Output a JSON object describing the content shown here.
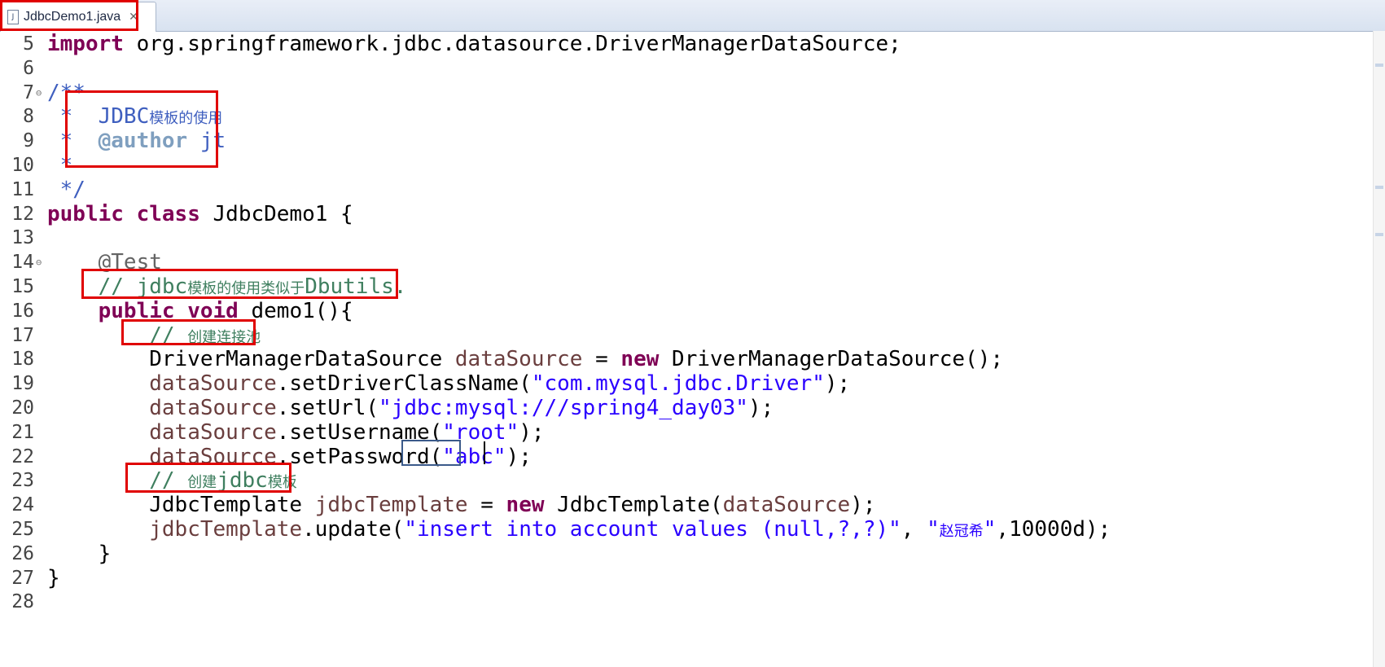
{
  "tab": {
    "label": "JdbcDemo1.java",
    "close_glyph": "✕",
    "icon": "java-file-icon"
  },
  "lines": [
    {
      "num": "5",
      "segments": [
        {
          "t": "import",
          "c": "kw"
        },
        {
          "t": " org.springframework.jdbc.datasource.DriverManagerDataSource;",
          "c": ""
        }
      ]
    },
    {
      "num": "6",
      "segments": []
    },
    {
      "num": "7",
      "fold": "⊖",
      "segments": [
        {
          "t": "/**",
          "c": "cm"
        }
      ]
    },
    {
      "num": "8",
      "segments": [
        {
          "t": " *  ",
          "c": "cm"
        },
        {
          "t": "JDBC",
          "c": "jd"
        },
        {
          "t": "模板的使用",
          "c": "jd cjk"
        }
      ]
    },
    {
      "num": "9",
      "segments": [
        {
          "t": " *  ",
          "c": "cm"
        },
        {
          "t": "@author",
          "c": "tag"
        },
        {
          "t": " jt",
          "c": "jd"
        }
      ]
    },
    {
      "num": "10",
      "segments": [
        {
          "t": " *",
          "c": "cm"
        }
      ]
    },
    {
      "num": "11",
      "segments": [
        {
          "t": " */",
          "c": "cm"
        }
      ]
    },
    {
      "num": "12",
      "segments": [
        {
          "t": "public",
          "c": "kw"
        },
        {
          "t": " ",
          "c": ""
        },
        {
          "t": "class",
          "c": "kw"
        },
        {
          "t": " JdbcDemo1 {",
          "c": ""
        }
      ]
    },
    {
      "num": "13",
      "segments": []
    },
    {
      "num": "14",
      "fold": "⊖",
      "segments": [
        {
          "t": "    @Test",
          "c": "ann"
        }
      ]
    },
    {
      "num": "15",
      "segments": [
        {
          "t": "    // jdbc",
          "c": "lc"
        },
        {
          "t": "模板的使用类似于",
          "c": "lc cjk"
        },
        {
          "t": "Dbutils.",
          "c": "lc"
        }
      ]
    },
    {
      "num": "16",
      "segments": [
        {
          "t": "    ",
          "c": ""
        },
        {
          "t": "public",
          "c": "kw"
        },
        {
          "t": " ",
          "c": ""
        },
        {
          "t": "void",
          "c": "kw"
        },
        {
          "t": " demo1(){",
          "c": ""
        }
      ]
    },
    {
      "num": "17",
      "segments": [
        {
          "t": "        // ",
          "c": "lc"
        },
        {
          "t": "创建连接池",
          "c": "lc cjk"
        }
      ]
    },
    {
      "num": "18",
      "segments": [
        {
          "t": "        DriverManagerDataSource ",
          "c": ""
        },
        {
          "t": "dataSource",
          "c": "var"
        },
        {
          "t": " = ",
          "c": ""
        },
        {
          "t": "new",
          "c": "kw"
        },
        {
          "t": " DriverManagerDataSource();",
          "c": ""
        }
      ]
    },
    {
      "num": "19",
      "segments": [
        {
          "t": "        ",
          "c": ""
        },
        {
          "t": "dataSource",
          "c": "var"
        },
        {
          "t": ".setDriverClassName(",
          "c": ""
        },
        {
          "t": "\"com.mysql.jdbc.Driver\"",
          "c": "str"
        },
        {
          "t": ");",
          "c": ""
        }
      ]
    },
    {
      "num": "20",
      "segments": [
        {
          "t": "        ",
          "c": ""
        },
        {
          "t": "dataSource",
          "c": "var"
        },
        {
          "t": ".setUrl(",
          "c": ""
        },
        {
          "t": "\"jdbc:mysql:///spring4_day03\"",
          "c": "str"
        },
        {
          "t": ");",
          "c": ""
        }
      ]
    },
    {
      "num": "21",
      "segments": [
        {
          "t": "        ",
          "c": ""
        },
        {
          "t": "dataSource",
          "c": "var"
        },
        {
          "t": ".setUsername(",
          "c": ""
        },
        {
          "t": "\"root\"",
          "c": "str"
        },
        {
          "t": ");",
          "c": ""
        }
      ]
    },
    {
      "num": "22",
      "segments": [
        {
          "t": "        ",
          "c": ""
        },
        {
          "t": "dataSource",
          "c": "var"
        },
        {
          "t": ".setPassword(",
          "c": ""
        },
        {
          "t": "\"abc\"",
          "c": "str"
        },
        {
          "t": ");",
          "c": ""
        }
      ]
    },
    {
      "num": "23",
      "segments": [
        {
          "t": "        // ",
          "c": "lc"
        },
        {
          "t": "创建",
          "c": "lc cjk"
        },
        {
          "t": "jdbc",
          "c": "lc"
        },
        {
          "t": "模板",
          "c": "lc cjk"
        }
      ]
    },
    {
      "num": "24",
      "segments": [
        {
          "t": "        JdbcTemplate ",
          "c": ""
        },
        {
          "t": "jdbcTemplate",
          "c": "var"
        },
        {
          "t": " = ",
          "c": ""
        },
        {
          "t": "new",
          "c": "kw"
        },
        {
          "t": " JdbcTemplate(",
          "c": ""
        },
        {
          "t": "dataSource",
          "c": "var"
        },
        {
          "t": ");",
          "c": ""
        }
      ]
    },
    {
      "num": "25",
      "segments": [
        {
          "t": "        ",
          "c": ""
        },
        {
          "t": "jdbcTemplate",
          "c": "var"
        },
        {
          "t": ".update(",
          "c": ""
        },
        {
          "t": "\"insert into account values (null,?,?)\"",
          "c": "str"
        },
        {
          "t": ", ",
          "c": ""
        },
        {
          "t": "\"",
          "c": "str"
        },
        {
          "t": "赵冠希",
          "c": "str cjk"
        },
        {
          "t": "\"",
          "c": "str"
        },
        {
          "t": ",10000d);",
          "c": ""
        }
      ]
    },
    {
      "num": "26",
      "segments": [
        {
          "t": "    }",
          "c": ""
        }
      ]
    },
    {
      "num": "27",
      "segments": [
        {
          "t": "}",
          "c": ""
        }
      ]
    },
    {
      "num": "28",
      "segments": []
    }
  ]
}
